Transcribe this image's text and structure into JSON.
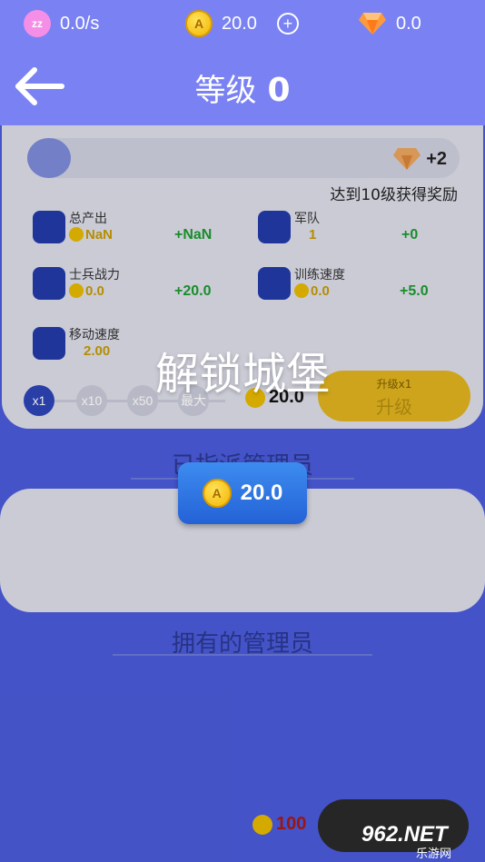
{
  "status": {
    "rate": "0.0/s",
    "coins": "20.0",
    "gems": "0.0"
  },
  "header": {
    "title": "等级",
    "level": "0"
  },
  "progress": {
    "reward": "+2",
    "caption": "达到10级获得奖励"
  },
  "stats": [
    {
      "label": "总产出",
      "value": "NaN",
      "delta": "+NaN"
    },
    {
      "label": "军队",
      "value": "1",
      "delta": "+0"
    },
    {
      "label": "士兵战力",
      "value": "0.0",
      "delta": "+20.0"
    },
    {
      "label": "训练速度",
      "value": "0.0",
      "delta": "+5.0"
    },
    {
      "label": "移动速度",
      "value": "2.00",
      "delta": ""
    }
  ],
  "multipliers": [
    "x1",
    "x10",
    "x50",
    "最大"
  ],
  "upgrade": {
    "cost": "20.0",
    "small_label": "升级x1",
    "label": "升级"
  },
  "sections": {
    "assigned": "已指派管理员",
    "owned": "拥有的管理员"
  },
  "bottom": {
    "cost": "100"
  },
  "unlock": {
    "title": "解锁城堡",
    "price": "20.0"
  },
  "watermark": {
    "brand": "962.NET",
    "sub": "乐游网"
  }
}
